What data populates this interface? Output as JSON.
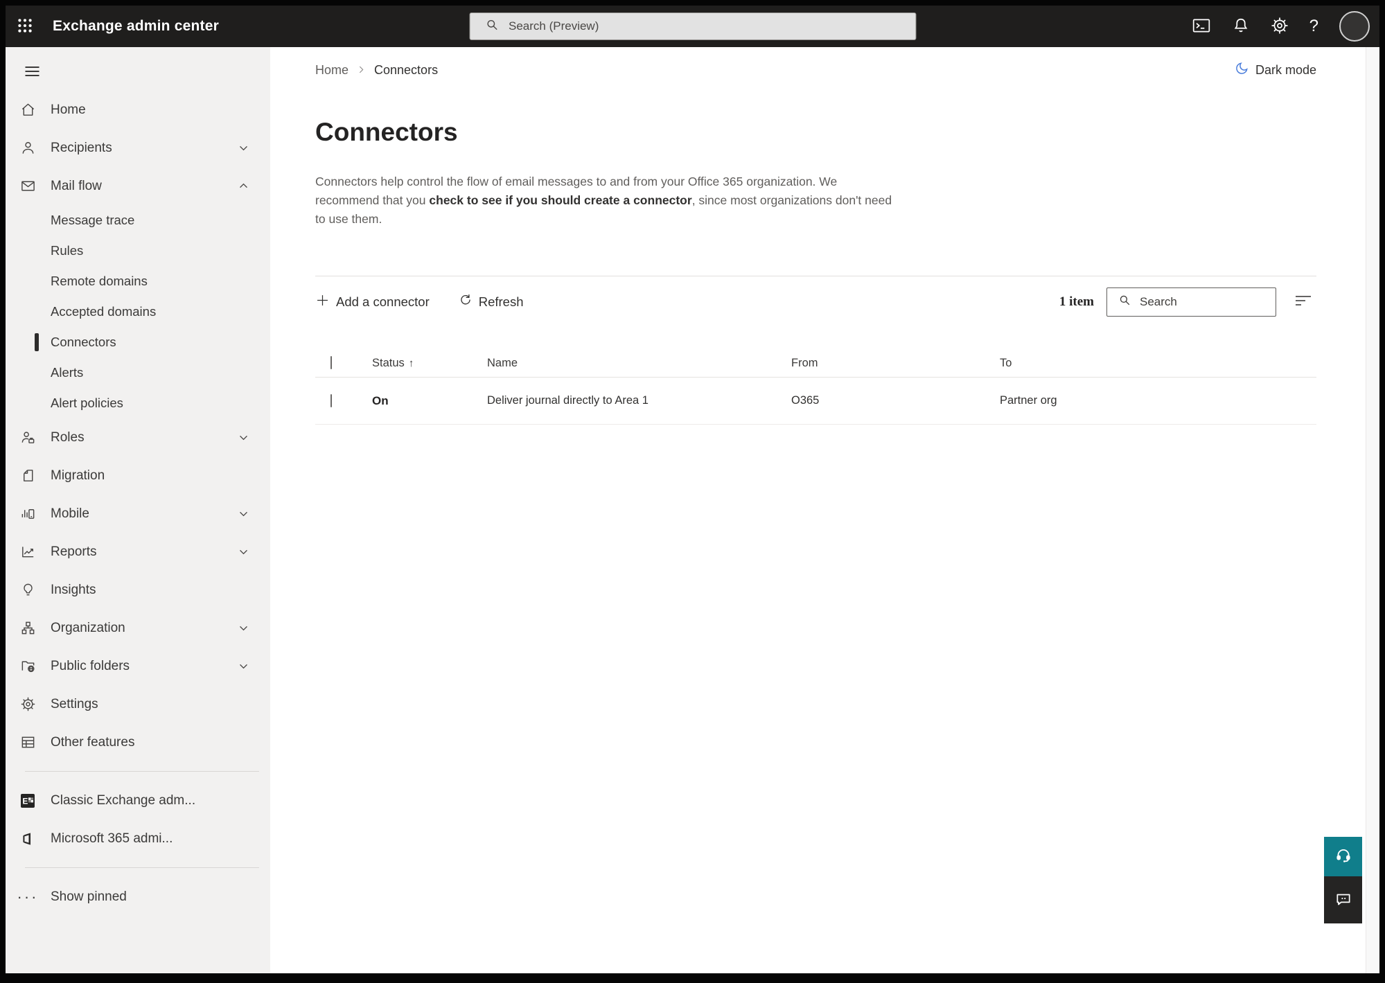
{
  "topbar": {
    "title": "Exchange admin center",
    "search_placeholder": "Search (Preview)"
  },
  "breadcrumb": {
    "home": "Home",
    "current": "Connectors"
  },
  "dark_mode_label": "Dark mode",
  "page": {
    "title": "Connectors",
    "description_prefix": "Connectors help control the flow of email messages to and from your Office 365 organization. We recommend that you ",
    "description_emphasis": "check to see if you should create a connector",
    "description_suffix": ", since most organizations don't need to use them."
  },
  "toolbar": {
    "add_label": "Add a connector",
    "refresh_label": "Refresh",
    "item_count": "1 item",
    "search_placeholder": "Search"
  },
  "table": {
    "headers": [
      "Status",
      "Name",
      "From",
      "To"
    ],
    "rows": [
      {
        "status": "On",
        "name": "Deliver journal directly to Area 1",
        "from": "O365",
        "to": "Partner org"
      }
    ]
  },
  "sidebar": {
    "items": [
      {
        "label": "Home"
      },
      {
        "label": "Recipients",
        "chevron": "down"
      },
      {
        "label": "Mail flow",
        "chevron": "up",
        "expanded": true
      },
      {
        "label": "Message trace",
        "type": "sub"
      },
      {
        "label": "Rules",
        "type": "sub"
      },
      {
        "label": "Remote domains",
        "type": "sub"
      },
      {
        "label": "Accepted domains",
        "type": "sub"
      },
      {
        "label": "Connectors",
        "type": "sub",
        "selected": true
      },
      {
        "label": "Alerts",
        "type": "sub"
      },
      {
        "label": "Alert policies",
        "type": "sub"
      },
      {
        "label": "Roles",
        "chevron": "down"
      },
      {
        "label": "Migration"
      },
      {
        "label": "Mobile",
        "chevron": "down"
      },
      {
        "label": "Reports",
        "chevron": "down"
      },
      {
        "label": "Insights"
      },
      {
        "label": "Organization",
        "chevron": "down"
      },
      {
        "label": "Public folders",
        "chevron": "down"
      },
      {
        "label": "Settings"
      },
      {
        "label": "Other features"
      },
      {
        "label": "Classic Exchange adm..."
      },
      {
        "label": "Microsoft 365 admi..."
      },
      {
        "label": "Show pinned"
      }
    ]
  },
  "icons": {
    "app_launcher": "waffle-grid",
    "moon": "crescent",
    "support": "headset",
    "feedback": "speech-bubble"
  },
  "colors": {
    "topbar_bg": "#1f1e1d",
    "sidebar_bg": "#f2f1f0",
    "accent_teal": "#107e8b",
    "dark_mode_blue": "#4a7ddb",
    "text_primary": "#323130",
    "text_secondary": "#605e5c"
  }
}
